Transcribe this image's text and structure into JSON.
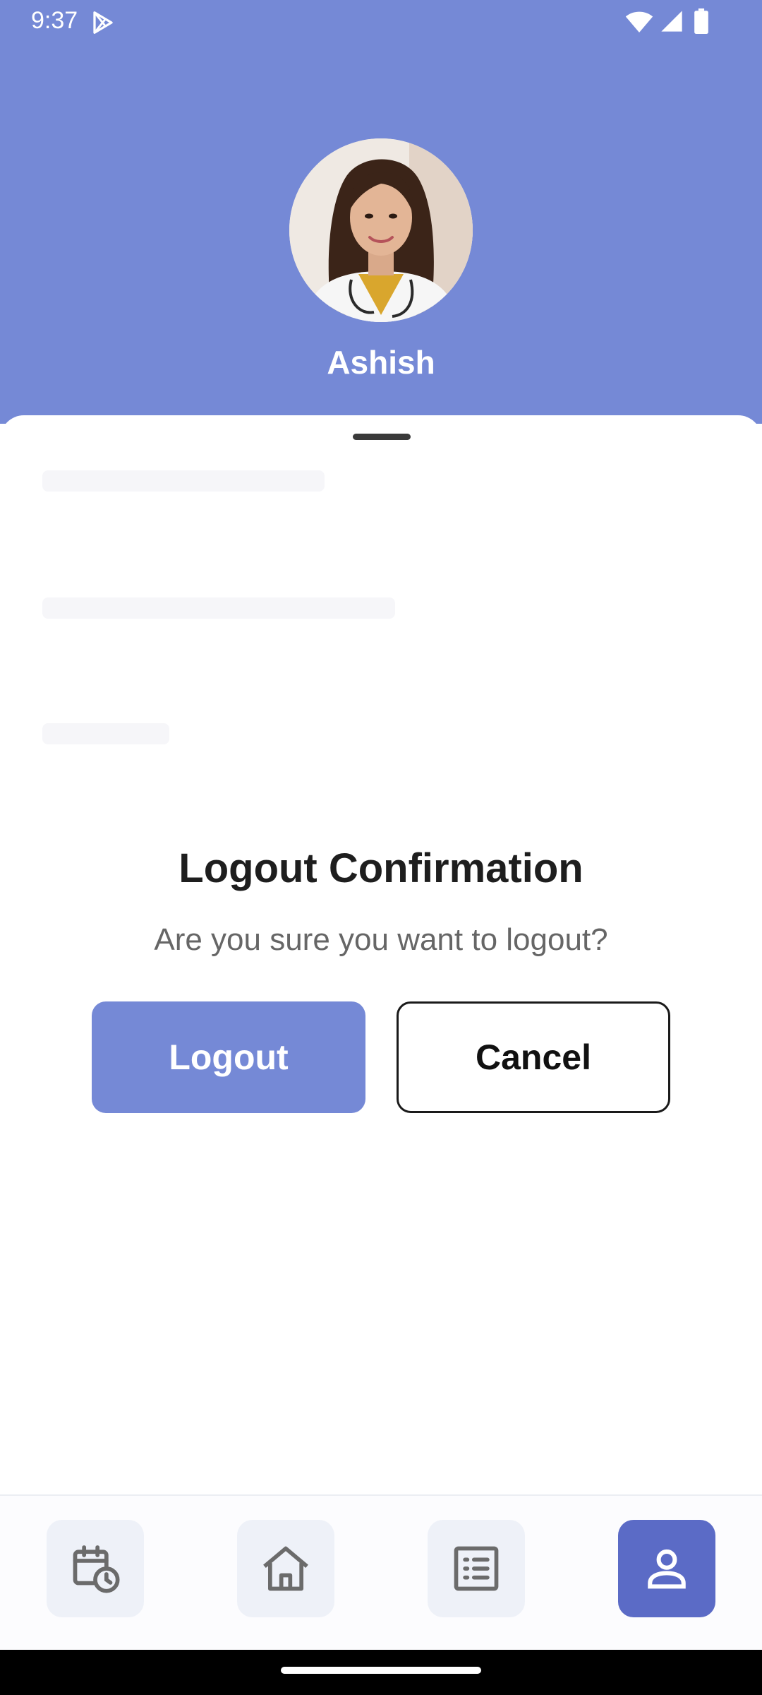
{
  "status_bar": {
    "time": "9:37",
    "icons": [
      "play-store-icon",
      "wifi-icon",
      "signal-icon",
      "battery-icon"
    ]
  },
  "profile": {
    "name": "Ashish",
    "avatar": "doctor-portrait"
  },
  "dialog": {
    "title": "Logout Confirmation",
    "message": "Are you sure you want to logout?",
    "confirm_label": "Logout",
    "cancel_label": "Cancel"
  },
  "bottom_nav": {
    "items": [
      {
        "icon": "calendar-clock-icon",
        "active": false
      },
      {
        "icon": "home-icon",
        "active": false
      },
      {
        "icon": "list-icon",
        "active": false
      },
      {
        "icon": "profile-icon",
        "active": true
      }
    ]
  },
  "colors": {
    "header": "#7589d6",
    "primary_button": "#7589d6",
    "active_nav": "#5b6bc6",
    "nav_bg": "#eef1f8",
    "nav_icon": "#6b6b6b"
  }
}
